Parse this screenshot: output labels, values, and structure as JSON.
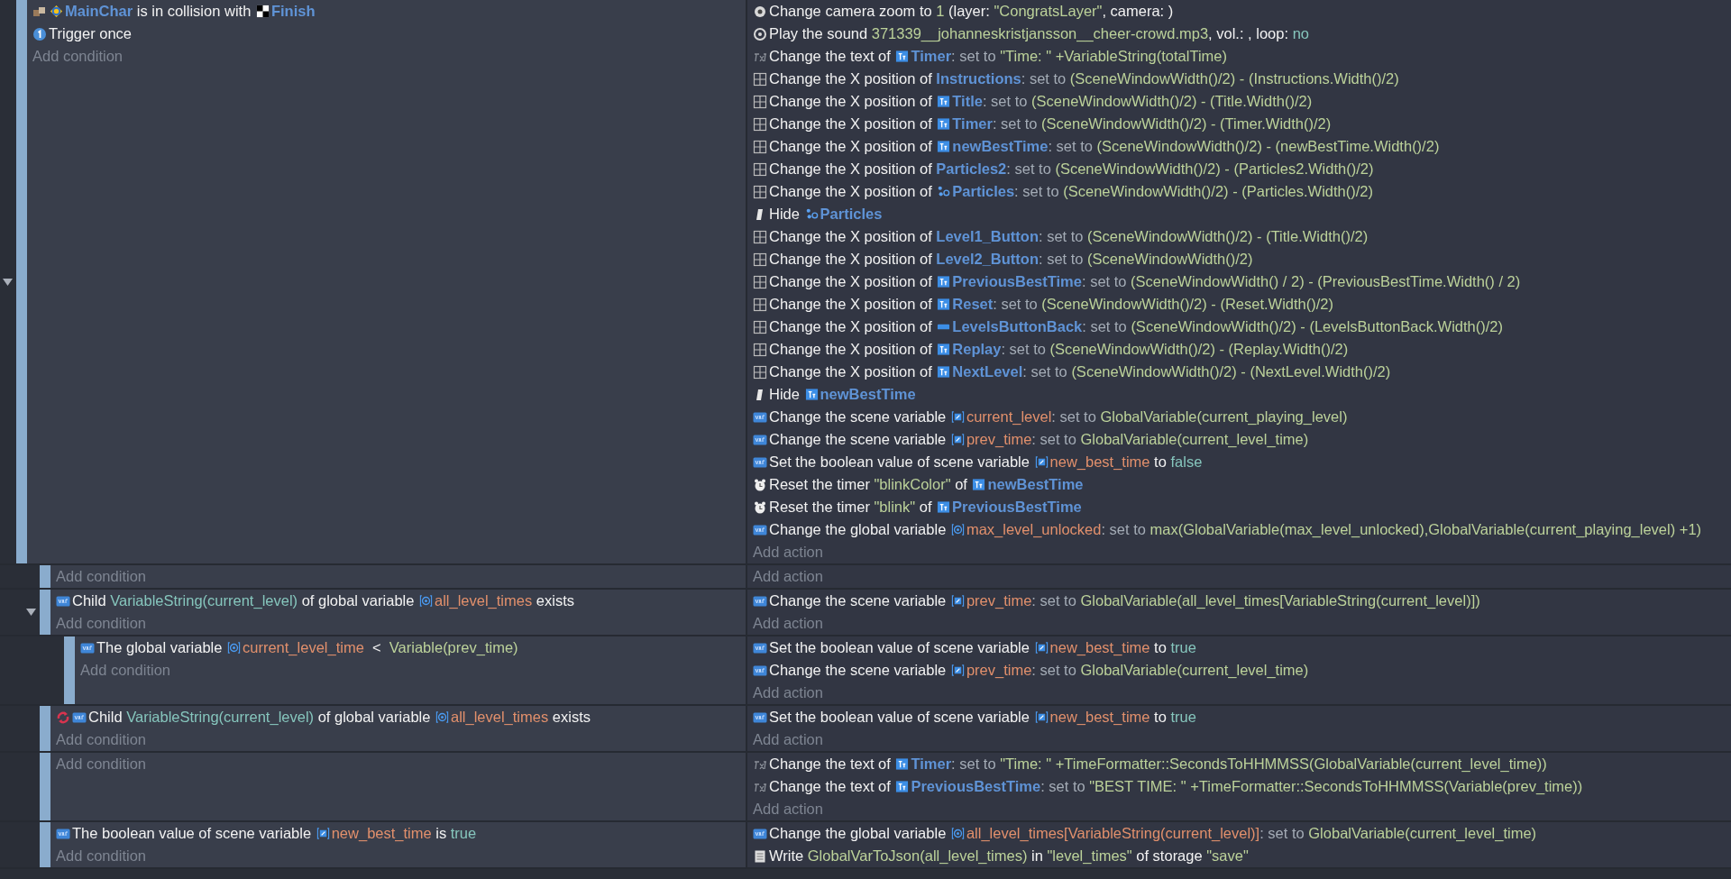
{
  "events": [
    {
      "expanded": true,
      "add_condition": "Add condition",
      "add_action": "Add action",
      "conditions": [
        {
          "kind": "collision",
          "inverted": false,
          "parts": [
            {
              "kind": "sprite_object",
              "text": "MainChar"
            },
            {
              "kind": "plain",
              "text": " is in collision with "
            },
            {
              "kind": "checker_object",
              "text": "Finish"
            }
          ]
        },
        {
          "kind": "trigger",
          "inverted": false,
          "parts": [
            {
              "kind": "plain",
              "text": "Trigger once"
            }
          ]
        }
      ],
      "actions": [
        {
          "kind": "camera",
          "parts": [
            {
              "kind": "plain",
              "text": "Change camera zoom to "
            },
            {
              "kind": "expr",
              "text": "1"
            },
            {
              "kind": "plain",
              "text": " (layer: "
            },
            {
              "kind": "expr",
              "text": "\"CongratsLayer\""
            },
            {
              "kind": "plain",
              "text": ", camera: )"
            }
          ]
        },
        {
          "kind": "sound",
          "parts": [
            {
              "kind": "plain",
              "text": "Play the sound "
            },
            {
              "kind": "expr",
              "text": "371339__johanneskristjansson__cheer-crowd.mp3"
            },
            {
              "kind": "plain",
              "text": ", vol.: , loop: "
            },
            {
              "kind": "val",
              "text": "no"
            }
          ]
        },
        {
          "kind": "text",
          "parts": [
            {
              "kind": "plain",
              "text": "Change the text of "
            },
            {
              "kind": "text_object",
              "text": "Timer"
            },
            {
              "kind": "key",
              "text": ": set to "
            },
            {
              "kind": "expr",
              "text": "\"Time: \" +VariableString(totalTime)"
            }
          ]
        },
        {
          "kind": "position",
          "parts": [
            {
              "kind": "plain",
              "text": "Change the X position of "
            },
            {
              "kind": "object",
              "text": "Instructions"
            },
            {
              "kind": "key",
              "text": ": set to "
            },
            {
              "kind": "expr",
              "text": "(SceneWindowWidth()/2) - (Instructions.Width()/2)"
            }
          ]
        },
        {
          "kind": "position",
          "parts": [
            {
              "kind": "plain",
              "text": "Change the X position of "
            },
            {
              "kind": "text_object",
              "text": "Title"
            },
            {
              "kind": "key",
              "text": ": set to "
            },
            {
              "kind": "expr",
              "text": "(SceneWindowWidth()/2) - (Title.Width()/2)"
            }
          ]
        },
        {
          "kind": "position",
          "parts": [
            {
              "kind": "plain",
              "text": "Change the X position of "
            },
            {
              "kind": "text_object",
              "text": "Timer"
            },
            {
              "kind": "key",
              "text": ": set to "
            },
            {
              "kind": "expr",
              "text": "(SceneWindowWidth()/2) - (Timer.Width()/2)"
            }
          ]
        },
        {
          "kind": "position",
          "parts": [
            {
              "kind": "plain",
              "text": "Change the X position of "
            },
            {
              "kind": "text_object",
              "text": "newBestTime"
            },
            {
              "kind": "key",
              "text": ": set to "
            },
            {
              "kind": "expr",
              "text": "(SceneWindowWidth()/2) - (newBestTime.Width()/2)"
            }
          ]
        },
        {
          "kind": "position",
          "parts": [
            {
              "kind": "plain",
              "text": "Change the X position of "
            },
            {
              "kind": "object",
              "text": "Particles2"
            },
            {
              "kind": "key",
              "text": ": set to "
            },
            {
              "kind": "expr",
              "text": "(SceneWindowWidth()/2) - (Particles2.Width()/2)"
            }
          ]
        },
        {
          "kind": "position",
          "parts": [
            {
              "kind": "plain",
              "text": "Change the X position of "
            },
            {
              "kind": "particles_object",
              "text": "Particles"
            },
            {
              "kind": "key",
              "text": ": set to "
            },
            {
              "kind": "expr",
              "text": "(SceneWindowWidth()/2) - (Particles.Width()/2)"
            }
          ]
        },
        {
          "kind": "visibility",
          "parts": [
            {
              "kind": "plain",
              "text": "Hide "
            },
            {
              "kind": "particles_object",
              "text": "Particles"
            }
          ]
        },
        {
          "kind": "position",
          "parts": [
            {
              "kind": "plain",
              "text": "Change the X position of "
            },
            {
              "kind": "object",
              "text": "Level1_Button"
            },
            {
              "kind": "key",
              "text": ": set to "
            },
            {
              "kind": "expr",
              "text": "(SceneWindowWidth()/2) - (Title.Width()/2)"
            }
          ]
        },
        {
          "kind": "position",
          "parts": [
            {
              "kind": "plain",
              "text": "Change the X position of "
            },
            {
              "kind": "object",
              "text": "Level2_Button"
            },
            {
              "kind": "key",
              "text": ": set to "
            },
            {
              "kind": "expr",
              "text": "(SceneWindowWidth()/2)"
            }
          ]
        },
        {
          "kind": "position",
          "parts": [
            {
              "kind": "plain",
              "text": "Change the X position of "
            },
            {
              "kind": "text_object",
              "text": "PreviousBestTime"
            },
            {
              "kind": "key",
              "text": ": set to "
            },
            {
              "kind": "expr",
              "text": "(SceneWindowWidth() / 2) - (PreviousBestTime.Width() / 2)"
            }
          ]
        },
        {
          "kind": "position",
          "parts": [
            {
              "kind": "plain",
              "text": "Change the X position of "
            },
            {
              "kind": "text_object",
              "text": "Reset"
            },
            {
              "kind": "key",
              "text": ": set to "
            },
            {
              "kind": "expr",
              "text": "(SceneWindowWidth()/2) - (Reset.Width()/2)"
            }
          ]
        },
        {
          "kind": "position",
          "parts": [
            {
              "kind": "plain",
              "text": "Change the X position of "
            },
            {
              "kind": "panel_object",
              "text": "LevelsButtonBack"
            },
            {
              "kind": "key",
              "text": ": set to "
            },
            {
              "kind": "expr",
              "text": "(SceneWindowWidth()/2) - (LevelsButtonBack.Width()/2)"
            }
          ]
        },
        {
          "kind": "position",
          "parts": [
            {
              "kind": "plain",
              "text": "Change the X position of "
            },
            {
              "kind": "text_object",
              "text": "Replay"
            },
            {
              "kind": "key",
              "text": ": set to "
            },
            {
              "kind": "expr",
              "text": "(SceneWindowWidth()/2) - (Replay.Width()/2)"
            }
          ]
        },
        {
          "kind": "position",
          "parts": [
            {
              "kind": "plain",
              "text": "Change the X position of "
            },
            {
              "kind": "text_object",
              "text": "NextLevel"
            },
            {
              "kind": "key",
              "text": ": set to "
            },
            {
              "kind": "expr",
              "text": "(SceneWindowWidth()/2) - (NextLevel.Width()/2)"
            }
          ]
        },
        {
          "kind": "visibility",
          "parts": [
            {
              "kind": "plain",
              "text": "Hide "
            },
            {
              "kind": "text_object",
              "text": "newBestTime"
            }
          ]
        },
        {
          "kind": "variable",
          "parts": [
            {
              "kind": "plain",
              "text": "Change the scene variable "
            },
            {
              "kind": "scene_var",
              "text": "current_level"
            },
            {
              "kind": "key",
              "text": ": set to "
            },
            {
              "kind": "expr",
              "text": "GlobalVariable(current_playing_level)"
            }
          ]
        },
        {
          "kind": "variable",
          "parts": [
            {
              "kind": "plain",
              "text": "Change the scene variable "
            },
            {
              "kind": "scene_var",
              "text": "prev_time"
            },
            {
              "kind": "key",
              "text": ": set to "
            },
            {
              "kind": "expr",
              "text": "GlobalVariable(current_level_time)"
            }
          ]
        },
        {
          "kind": "variable",
          "parts": [
            {
              "kind": "plain",
              "text": "Set the boolean value of scene variable "
            },
            {
              "kind": "scene_var",
              "text": "new_best_time"
            },
            {
              "kind": "plain",
              "text": " to "
            },
            {
              "kind": "val",
              "text": "false"
            }
          ]
        },
        {
          "kind": "timer",
          "parts": [
            {
              "kind": "plain",
              "text": "Reset the timer "
            },
            {
              "kind": "expr",
              "text": "\"blinkColor\""
            },
            {
              "kind": "plain",
              "text": " of "
            },
            {
              "kind": "text_object",
              "text": "newBestTime"
            }
          ]
        },
        {
          "kind": "timer",
          "parts": [
            {
              "kind": "plain",
              "text": "Reset the timer "
            },
            {
              "kind": "expr",
              "text": "\"blink\""
            },
            {
              "kind": "plain",
              "text": " of "
            },
            {
              "kind": "text_object",
              "text": "PreviousBestTime"
            }
          ]
        },
        {
          "kind": "variable",
          "parts": [
            {
              "kind": "plain",
              "text": "Change the global variable "
            },
            {
              "kind": "global_var",
              "text": "max_level_unlocked"
            },
            {
              "kind": "key",
              "text": ": set to "
            },
            {
              "kind": "expr",
              "text": "max(GlobalVariable(max_level_unlocked),GlobalVariable(current_playing_level) +1)"
            }
          ]
        }
      ],
      "children": [
        {
          "add_condition": "Add condition",
          "add_action": "Add action"
        },
        {
          "expanded": true,
          "add_condition": "Add condition",
          "add_action": "Add action",
          "conditions": [
            {
              "kind": "variable",
              "inverted": false,
              "parts": [
                {
                  "kind": "plain",
                  "text": "Child "
                },
                {
                  "kind": "val",
                  "text": "VariableString(current_level)"
                },
                {
                  "kind": "plain",
                  "text": " of global variable "
                },
                {
                  "kind": "global_var",
                  "text": "all_level_times"
                },
                {
                  "kind": "plain",
                  "text": " exists"
                }
              ]
            }
          ],
          "actions": [
            {
              "kind": "variable",
              "parts": [
                {
                  "kind": "plain",
                  "text": "Change the scene variable "
                },
                {
                  "kind": "scene_var",
                  "text": "prev_time"
                },
                {
                  "kind": "key",
                  "text": ": set to "
                },
                {
                  "kind": "expr",
                  "text": "GlobalVariable(all_level_times[VariableString(current_level)])"
                }
              ]
            }
          ],
          "children": [
            {
              "add_condition": "Add condition",
              "add_action": "Add action",
              "conditions": [
                {
                  "kind": "variable",
                  "inverted": false,
                  "parts": [
                    {
                      "kind": "plain",
                      "text": "The global variable "
                    },
                    {
                      "kind": "global_var",
                      "text": "current_level_time"
                    },
                    {
                      "kind": "plain",
                      "text": "  <  "
                    },
                    {
                      "kind": "expr",
                      "text": "Variable(prev_time)"
                    }
                  ]
                }
              ],
              "actions": [
                {
                  "kind": "variable",
                  "parts": [
                    {
                      "kind": "plain",
                      "text": "Set the boolean value of scene variable "
                    },
                    {
                      "kind": "scene_var",
                      "text": "new_best_time"
                    },
                    {
                      "kind": "plain",
                      "text": " to "
                    },
                    {
                      "kind": "val",
                      "text": "true"
                    }
                  ]
                },
                {
                  "kind": "variable",
                  "parts": [
                    {
                      "kind": "plain",
                      "text": "Change the scene variable "
                    },
                    {
                      "kind": "scene_var",
                      "text": "prev_time"
                    },
                    {
                      "kind": "key",
                      "text": ": set to "
                    },
                    {
                      "kind": "expr",
                      "text": "GlobalVariable(current_level_time)"
                    }
                  ]
                }
              ]
            }
          ]
        },
        {
          "add_condition": "Add condition",
          "add_action": "Add action",
          "conditions": [
            {
              "kind": "variable",
              "inverted": true,
              "parts": [
                {
                  "kind": "plain",
                  "text": "Child "
                },
                {
                  "kind": "val",
                  "text": "VariableString(current_level)"
                },
                {
                  "kind": "plain",
                  "text": " of global variable "
                },
                {
                  "kind": "global_var",
                  "text": "all_level_times"
                },
                {
                  "kind": "plain",
                  "text": " exists"
                }
              ]
            }
          ],
          "actions": [
            {
              "kind": "variable",
              "parts": [
                {
                  "kind": "plain",
                  "text": "Set the boolean value of scene variable "
                },
                {
                  "kind": "scene_var",
                  "text": "new_best_time"
                },
                {
                  "kind": "plain",
                  "text": " to "
                },
                {
                  "kind": "val",
                  "text": "true"
                }
              ]
            }
          ]
        },
        {
          "add_condition": "Add condition",
          "add_action": "Add action",
          "actions": [
            {
              "kind": "text",
              "parts": [
                {
                  "kind": "plain",
                  "text": "Change the text of "
                },
                {
                  "kind": "text_object",
                  "text": "Timer"
                },
                {
                  "kind": "key",
                  "text": ": set to "
                },
                {
                  "kind": "expr",
                  "text": "\"Time: \" +TimeFormatter::SecondsToHHMMSS(GlobalVariable(current_level_time))"
                }
              ]
            },
            {
              "kind": "text",
              "parts": [
                {
                  "kind": "plain",
                  "text": "Change the text of "
                },
                {
                  "kind": "text_object",
                  "text": "PreviousBestTime"
                },
                {
                  "kind": "key",
                  "text": ": set to "
                },
                {
                  "kind": "expr",
                  "text": "\"BEST TIME: \" +TimeFormatter::SecondsToHHMMSS(Variable(prev_time))"
                }
              ]
            }
          ]
        },
        {
          "add_condition": "Add condition",
          "conditions": [
            {
              "kind": "variable",
              "inverted": false,
              "parts": [
                {
                  "kind": "plain",
                  "text": "The boolean value of scene variable "
                },
                {
                  "kind": "scene_var",
                  "text": "new_best_time"
                },
                {
                  "kind": "plain",
                  "text": " is "
                },
                {
                  "kind": "val",
                  "text": "true"
                }
              ]
            }
          ],
          "actions": [
            {
              "kind": "variable",
              "parts": [
                {
                  "kind": "plain",
                  "text": "Change the global variable "
                },
                {
                  "kind": "global_var",
                  "text": "all_level_times[VariableString(current_level)]"
                },
                {
                  "kind": "key",
                  "text": ": set to "
                },
                {
                  "kind": "expr",
                  "text": "GlobalVariable(current_level_time)"
                }
              ]
            },
            {
              "kind": "storage",
              "parts": [
                {
                  "kind": "plain",
                  "text": "Write "
                },
                {
                  "kind": "expr",
                  "text": "GlobalVarToJson(all_level_times)"
                },
                {
                  "kind": "plain",
                  "text": " in "
                },
                {
                  "kind": "expr",
                  "text": "\"level_times\""
                },
                {
                  "kind": "plain",
                  "text": " of storage "
                },
                {
                  "kind": "expr",
                  "text": "\"save\""
                }
              ]
            }
          ]
        }
      ]
    }
  ]
}
